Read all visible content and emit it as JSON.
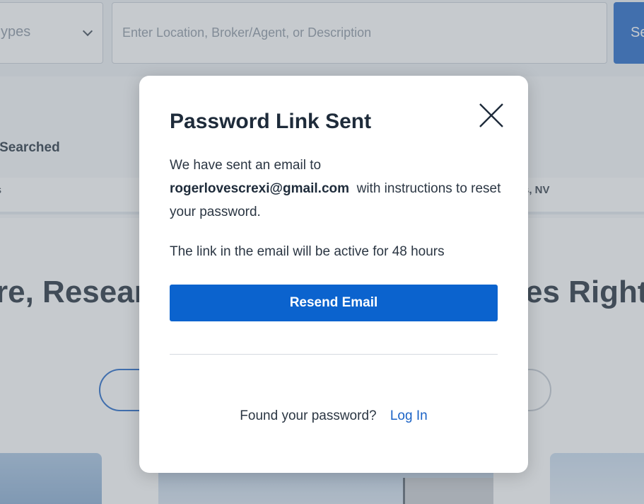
{
  "background": {
    "search": {
      "type_select_value": "ypes",
      "location_placeholder": "Enter Location, Broker/Agent, or Description",
      "search_button_label": "Se"
    },
    "recent": {
      "title": "ly Searched",
      "left_item": "ms",
      "right_item": "s, NV"
    },
    "hero": {
      "title": "re, Resear                                             es Right"
    }
  },
  "modal": {
    "title": "Password Link Sent",
    "message_prefix": "We have sent an email to",
    "email": "rogerlovescrexi@gmail.com",
    "message_suffix": "with instructions to reset your password.",
    "expiry_note": "The link in the email will be active for 48 hours",
    "resend_button_label": "Resend Email",
    "footer_question": "Found your password?",
    "login_link": "Log In",
    "close_icon": "close-icon",
    "colors": {
      "primary": "#0b63ce",
      "link": "#1b63c6"
    }
  }
}
